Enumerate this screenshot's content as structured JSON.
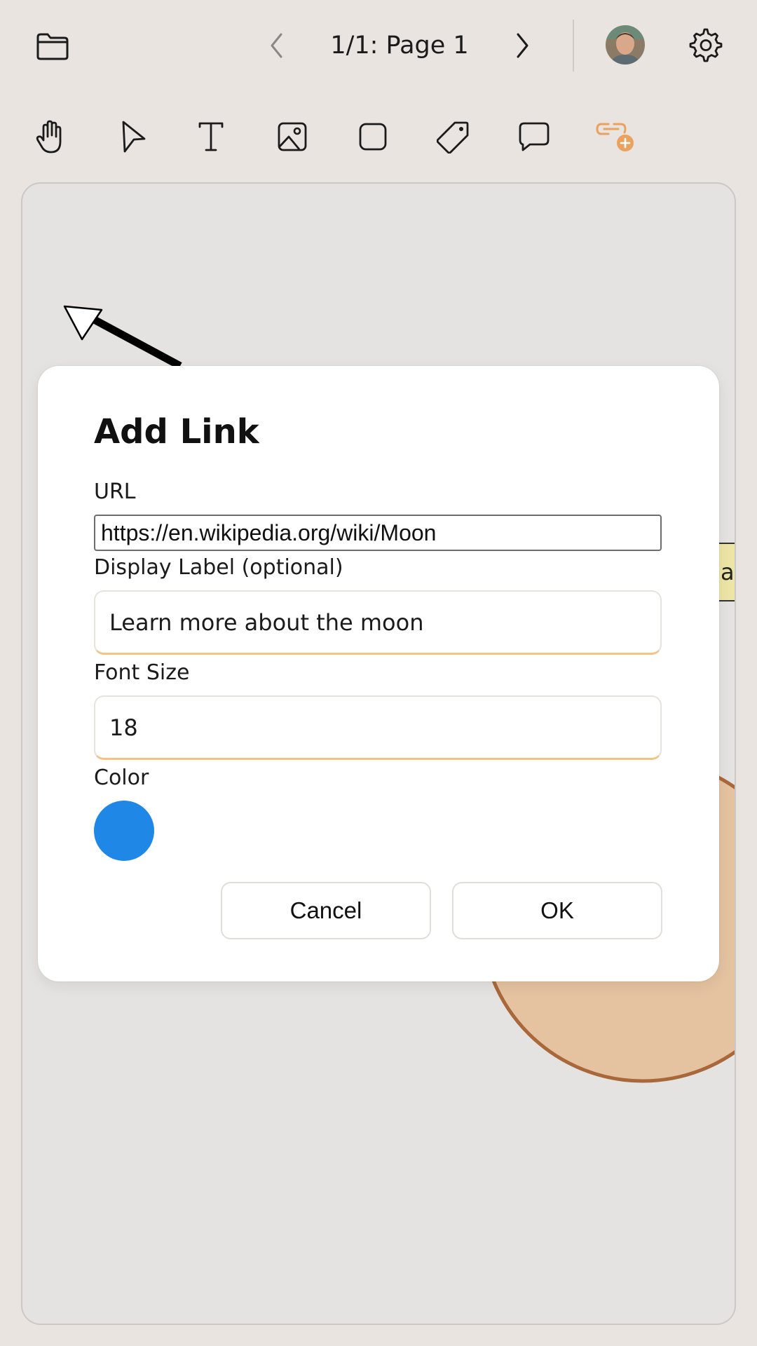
{
  "header": {
    "page_label": "1/1: Page 1",
    "icons": {
      "folder": "folder-icon",
      "prev": "chevron-left-icon",
      "next": "chevron-right-icon",
      "avatar": "user-avatar",
      "settings": "gear-icon"
    }
  },
  "toolbar": {
    "tools": [
      {
        "name": "hand-tool",
        "icon": "hand-icon"
      },
      {
        "name": "select-tool",
        "icon": "pointer-icon"
      },
      {
        "name": "text-tool",
        "icon": "text-icon"
      },
      {
        "name": "image-tool",
        "icon": "image-icon"
      },
      {
        "name": "shape-tool",
        "icon": "square-icon"
      },
      {
        "name": "tag-tool",
        "icon": "tag-icon"
      },
      {
        "name": "comment-tool",
        "icon": "speech-bubble-icon"
      },
      {
        "name": "add-link-tool",
        "icon": "link-add-icon",
        "active": true
      }
    ],
    "active_color": "#e9a25f"
  },
  "canvas": {
    "note_text": "a"
  },
  "dialog": {
    "title": "Add Link",
    "url_label": "URL",
    "url_value": "https://en.wikipedia.org/wiki/Moon",
    "display_label_label": "Display Label (optional)",
    "display_label_value": "Learn more about the moon",
    "font_size_label": "Font Size",
    "font_size_value": "18",
    "color_label": "Color",
    "color_value": "#1f87e5",
    "cancel_label": "Cancel",
    "ok_label": "OK"
  }
}
